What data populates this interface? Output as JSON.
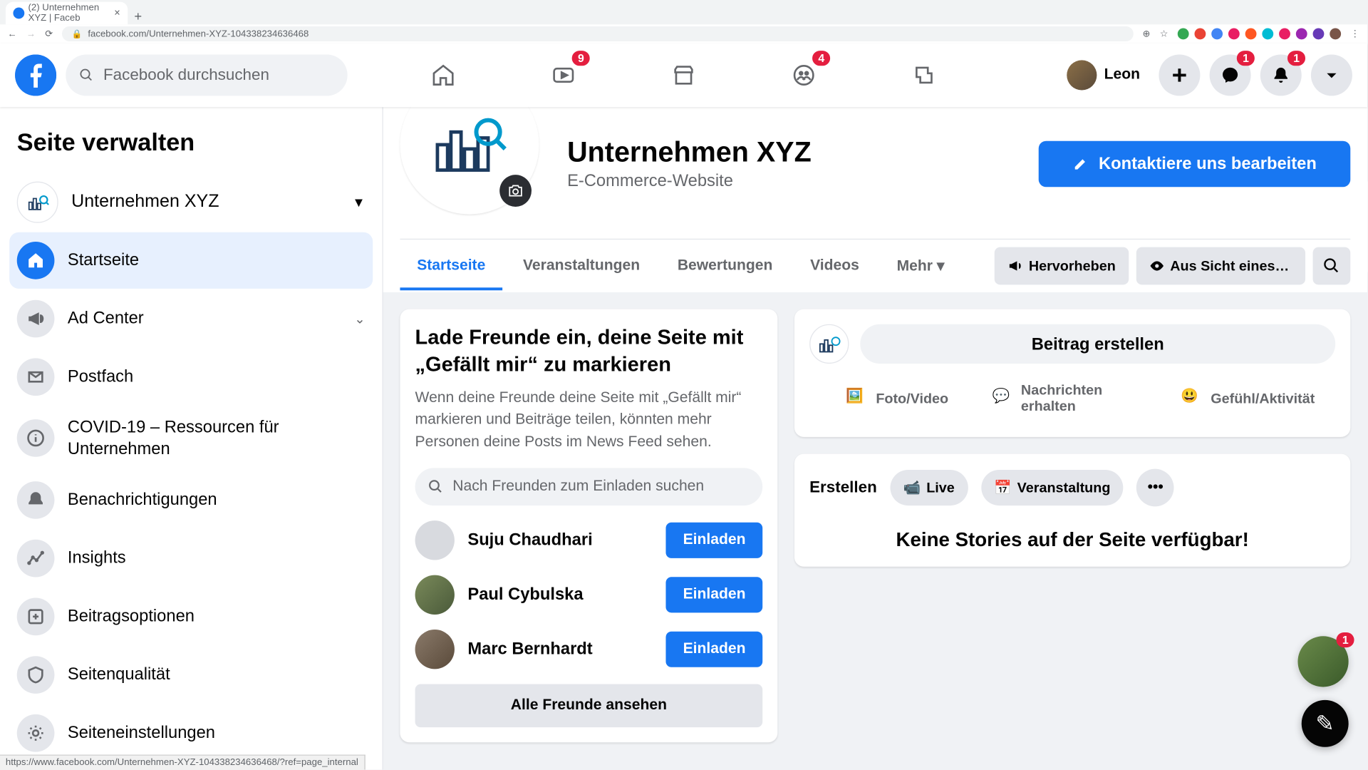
{
  "chrome": {
    "tab_title": "(2) Unternehmen XYZ | Faceb",
    "url": "facebook.com/Unternehmen-XYZ-104338234636468",
    "status": "https://www.facebook.com/Unternehmen-XYZ-104338234636468/?ref=page_internal"
  },
  "header": {
    "search_placeholder": "Facebook durchsuchen",
    "watch_badge": "9",
    "groups_badge": "4",
    "profile_name": "Leon",
    "messenger_badge": "1",
    "notif_badge": "1"
  },
  "sidebar": {
    "title": "Seite verwalten",
    "page_name": "Unternehmen XYZ",
    "items": [
      {
        "label": "Startseite"
      },
      {
        "label": "Ad Center"
      },
      {
        "label": "Postfach"
      },
      {
        "label": "COVID-19 – Ressourcen für Unternehmen"
      },
      {
        "label": "Benachrichtigungen"
      },
      {
        "label": "Insights"
      },
      {
        "label": "Beitragsoptionen"
      },
      {
        "label": "Seitenqualität"
      },
      {
        "label": "Seiteneinstellungen"
      }
    ]
  },
  "page": {
    "title": "Unternehmen XYZ",
    "subtitle": "E-Commerce-Website",
    "contact_btn": "Kontaktiere uns bearbeiten",
    "tabs": [
      "Startseite",
      "Veranstaltungen",
      "Bewertungen",
      "Videos",
      "Mehr"
    ],
    "actions": {
      "promote": "Hervorheben",
      "view_as": "Aus Sicht eines Be..."
    }
  },
  "invite": {
    "title": "Lade Freunde ein, deine Seite mit „Gefällt mir“ zu markieren",
    "desc": "Wenn deine Freunde deine Seite mit „Gefällt mir“ markieren und Beiträge teilen, könnten mehr Personen deine Posts im News Feed sehen.",
    "search_placeholder": "Nach Freunden zum Einladen suchen",
    "friends": [
      {
        "name": "Suju Chaudhari"
      },
      {
        "name": "Paul Cybulska"
      },
      {
        "name": "Marc Bernhardt"
      }
    ],
    "invite_btn": "Einladen",
    "all_btn": "Alle Freunde ansehen"
  },
  "compose": {
    "input": "Beitrag erstellen",
    "opts": [
      "Foto/Video",
      "Nachrichten erhalten",
      "Gefühl/Aktivität"
    ]
  },
  "stories": {
    "create": "Erstellen",
    "live": "Live",
    "event": "Veranstaltung",
    "empty": "Keine Stories auf der Seite verfügbar!"
  },
  "float_badge": "1"
}
